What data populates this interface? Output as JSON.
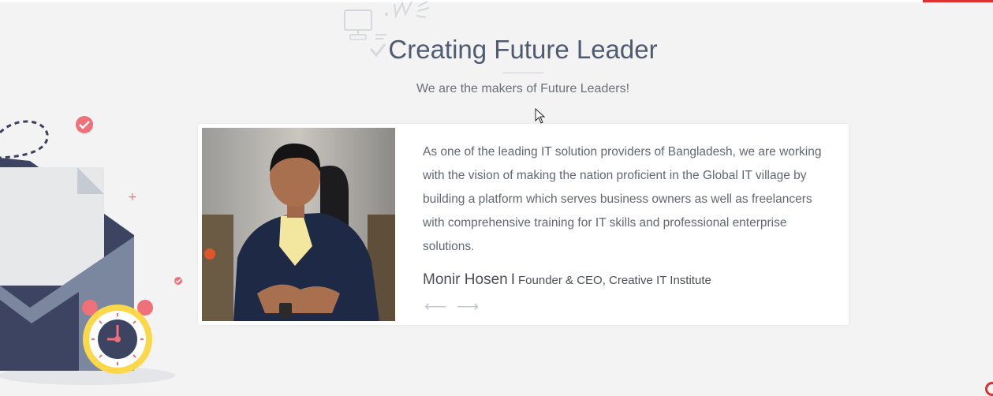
{
  "section": {
    "title": "Creating Future Leader",
    "subtitle": "We are the makers of Future Leaders!"
  },
  "testimonial": {
    "quote": "As one of the leading IT solution providers of Bangladesh, we are working with the vision of making the nation proficient in the Global IT village by building a platform which serves business owners as well as freelancers with comprehensive training for IT skills and professional enterprise solutions.",
    "author_name": "Monir Hosen",
    "separator": "I",
    "author_role": "Founder & CEO, Creative IT Institute",
    "prev_arrow": "⟵",
    "next_arrow": "⟶"
  },
  "icons": {
    "prev": "arrow-left-icon",
    "next": "arrow-right-icon",
    "decoration": [
      "monitor-icon",
      "envelope-icon",
      "alarm-clock-icon",
      "checkmark-icon"
    ]
  },
  "colors": {
    "background": "#f3f3f4",
    "title": "#4f5b70",
    "accent": "#e03131",
    "text": "#616872",
    "clock": "#fbd84a",
    "badge": "#f0707a"
  }
}
